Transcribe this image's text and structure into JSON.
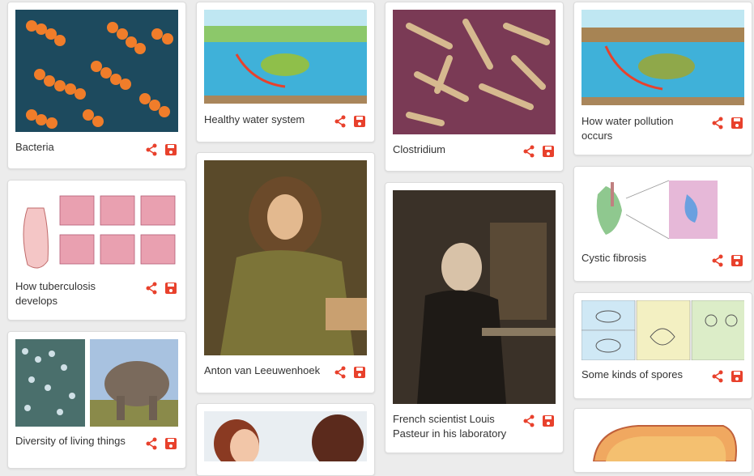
{
  "cards": [
    {
      "caption": "Bacteria"
    },
    {
      "caption": "How tuberculosis develops"
    },
    {
      "caption": "Diversity of living things"
    },
    {
      "caption": "Healthy water system"
    },
    {
      "caption": "Anton van Leeuwenhoek"
    },
    {
      "caption": "Clostridium"
    },
    {
      "caption": "French scientist Louis Pasteur in his laboratory"
    },
    {
      "caption": "How water pollution occurs"
    },
    {
      "caption": "Cystic fibrosis"
    },
    {
      "caption": "Some kinds of spores"
    }
  ],
  "colors": {
    "accent": "#e8412c"
  }
}
